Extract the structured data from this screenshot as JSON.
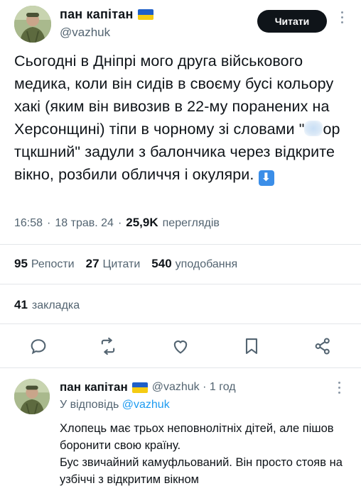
{
  "tweet": {
    "author_name": "пан капітан",
    "author_handle": "@vazhuk",
    "read_button": "Читати",
    "text_part1": "Сьогодні в Дніпрі мого друга військового медика, коли він сидів в своєму бусі кольору хакі (яким він вивозив в 22-му поранених на Херсонщині) тіпи в чорному зі словами \"",
    "text_part2": "ор тцкшний\" задули з балончика через відкрите вікно, розбили обличчя і окуляри.",
    "arrow_emoji": "⬇",
    "time": "16:58",
    "date": "18 трав. 24",
    "views": "25,9K",
    "views_label": "переглядів",
    "separator": "·"
  },
  "stats": {
    "reposts_count": "95",
    "reposts_label": "Репости",
    "quotes_count": "27",
    "quotes_label": "Цитати",
    "likes_count": "540",
    "likes_label": "уподобання",
    "bookmarks_count": "41",
    "bookmarks_label": "закладка"
  },
  "actions": [
    "reply-icon",
    "repost-icon",
    "like-icon",
    "bookmark-icon",
    "share-icon"
  ],
  "reply": {
    "author_name": "пан капітан",
    "meta": "@vazhuk · 1 год",
    "reply_to_prefix": "У відповідь",
    "reply_to_handle": "@vazhuk",
    "text_line1": "Хлопець має трьох неповнолітніх дітей, але пішов боронити свою країну.",
    "text_line2": "Бус звичайний камуфльований. Він просто стояв на узбіччі з відкритим вікном"
  },
  "colors": {
    "flag_blue": "#1f5fc8",
    "flag_yellow": "#f5cb12",
    "secondary_text": "#536471",
    "link": "#1d9bf0",
    "button_bg": "#0f1419"
  }
}
